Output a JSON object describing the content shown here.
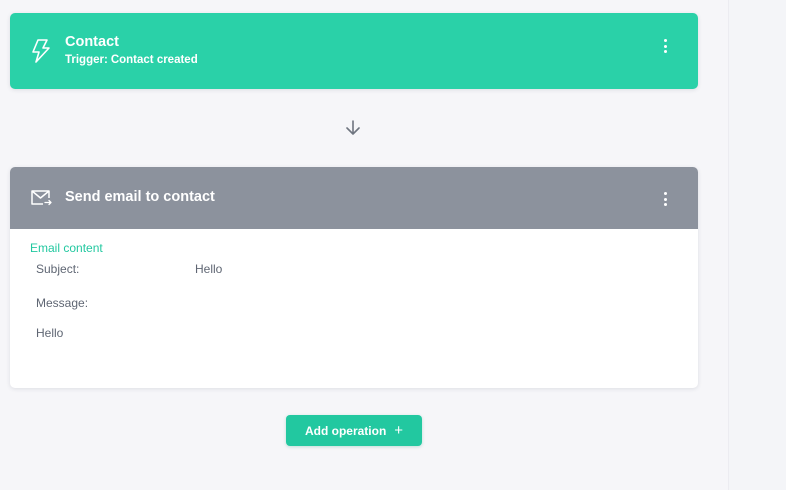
{
  "colors": {
    "trigger_bg": "#2ad1a8",
    "action_header_bg": "#8c929d",
    "accent": "#22c8a0",
    "page_bg": "#f6f6f9",
    "text_muted": "#5f6673"
  },
  "trigger": {
    "title": "Contact",
    "subtitle_prefix": "Trigger:",
    "subtitle_value": "Contact created",
    "icon": "lightning-bolt-icon",
    "menu_icon": "kebab-menu-icon"
  },
  "connector": {
    "icon": "arrow-down-icon"
  },
  "action": {
    "title": "Send email to contact",
    "icon": "mail-send-icon",
    "menu_icon": "kebab-menu-icon",
    "section_label": "Email content",
    "fields": {
      "subject_label": "Subject:",
      "subject_value": "Hello",
      "message_label": "Message:",
      "message_value": "Hello"
    }
  },
  "add_operation": {
    "label": "Add operation",
    "icon": "plus-icon",
    "icon_glyph": "+"
  }
}
